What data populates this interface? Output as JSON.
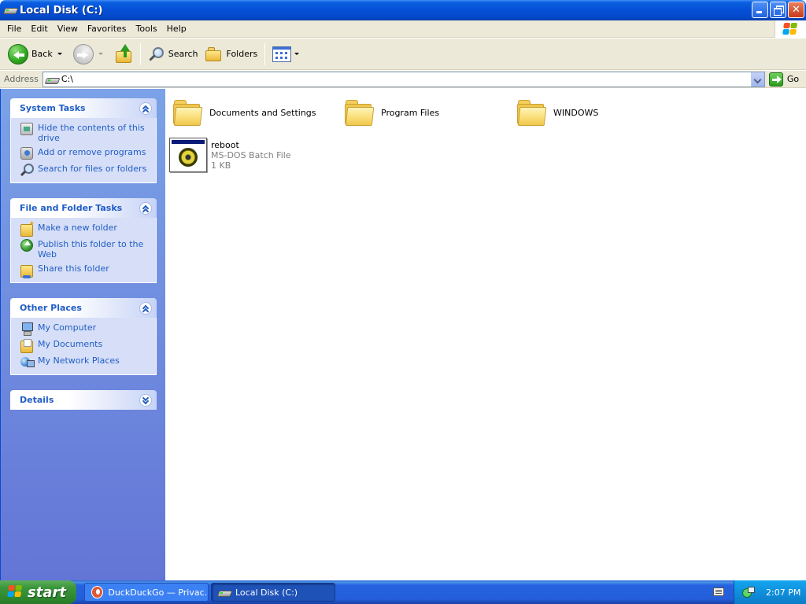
{
  "window": {
    "title": "Local Disk (C:)",
    "icon": "drive-icon"
  },
  "menu": [
    "File",
    "Edit",
    "View",
    "Favorites",
    "Tools",
    "Help"
  ],
  "toolbar": {
    "back": "Back",
    "search": "Search",
    "folders": "Folders"
  },
  "address": {
    "label": "Address",
    "value": "C:\\",
    "go": "Go"
  },
  "sidebar": {
    "panels": [
      {
        "title": "System Tasks",
        "items": [
          {
            "label": "Hide the contents of this drive",
            "icon": "hide-contents-icon"
          },
          {
            "label": "Add or remove programs",
            "icon": "add-remove-programs-icon"
          },
          {
            "label": "Search for files or folders",
            "icon": "search-icon"
          }
        ]
      },
      {
        "title": "File and Folder Tasks",
        "items": [
          {
            "label": "Make a new folder",
            "icon": "new-folder-icon"
          },
          {
            "label": "Publish this folder to the Web",
            "icon": "publish-web-icon"
          },
          {
            "label": "Share this folder",
            "icon": "share-folder-icon"
          }
        ]
      },
      {
        "title": "Other Places",
        "items": [
          {
            "label": "My Computer",
            "icon": "my-computer-icon"
          },
          {
            "label": "My Documents",
            "icon": "my-documents-icon"
          },
          {
            "label": "My Network Places",
            "icon": "network-places-icon"
          }
        ]
      },
      {
        "title": "Details",
        "items": []
      }
    ]
  },
  "files": [
    {
      "name": "Documents and Settings",
      "type": "folder"
    },
    {
      "name": "Program Files",
      "type": "folder"
    },
    {
      "name": "WINDOWS",
      "type": "folder"
    },
    {
      "name": "reboot",
      "type": "MS-DOS Batch File",
      "size": "1 KB"
    }
  ],
  "taskbar": {
    "start": "start",
    "items": [
      {
        "label": "DuckDuckGo — Privac...",
        "state": "inactive"
      },
      {
        "label": "Local Disk (C:)",
        "state": "active"
      }
    ],
    "clock": "2:07 PM"
  },
  "colors": {
    "titlebar": "#0550d8",
    "sidebar": "#7ba2e7",
    "panel_title": "#215dc6",
    "start_button": "#3c963c"
  }
}
